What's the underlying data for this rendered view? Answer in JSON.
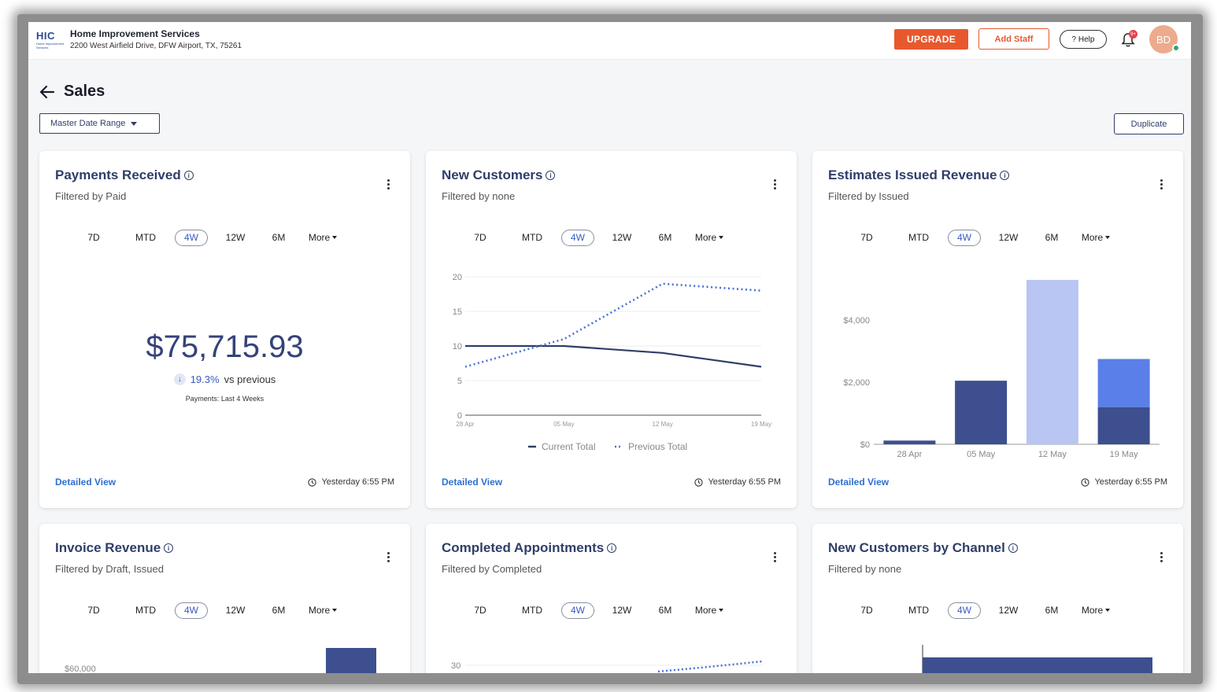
{
  "header": {
    "logo_text": "HIC",
    "logo_sub": "Home Improvement Services",
    "company_name": "Home Improvement Services",
    "company_address": "2200 West Airfield Drive, DFW Airport, TX, 75261",
    "upgrade_label": "UPGRADE",
    "add_staff_label": "Add Staff",
    "help_label": "? Help",
    "notification_badge": "9+",
    "avatar_initials": "BD",
    "accent_color": "#e8582d"
  },
  "page": {
    "title": "Sales",
    "date_range_label": "Master Date Range",
    "duplicate_label": "Duplicate"
  },
  "range_options": [
    "7D",
    "MTD",
    "4W",
    "12W",
    "6M"
  ],
  "range_more": "More",
  "cards": [
    {
      "title": "Payments Received",
      "filter": "Filtered by Paid",
      "active_range": "4W",
      "value": "$75,715.93",
      "delta_pct": "19.3%",
      "delta_vs": "vs previous",
      "delta_direction": "down",
      "period_note": "Payments: Last 4 Weeks",
      "detailed_view": "Detailed View",
      "updated": "Yesterday 6:55 PM"
    },
    {
      "title": "New Customers",
      "filter": "Filtered by none",
      "active_range": "4W",
      "detailed_view": "Detailed View",
      "updated": "Yesterday 6:55 PM"
    },
    {
      "title": "Estimates Issued Revenue",
      "filter": "Filtered by Issued",
      "active_range": "4W",
      "detailed_view": "Detailed View",
      "updated": "Yesterday 6:55 PM"
    },
    {
      "title": "Invoice Revenue",
      "filter": "Filtered by Draft, Issued",
      "active_range": "4W"
    },
    {
      "title": "Completed Appointments",
      "filter": "Filtered by Completed",
      "active_range": "4W"
    },
    {
      "title": "New Customers by Channel",
      "filter": "Filtered by none",
      "active_range": "4W"
    }
  ],
  "chart_data": [
    {
      "type": "line",
      "x": [
        "28 Apr",
        "05 May",
        "12 May",
        "19 May"
      ],
      "ylim": [
        0,
        20
      ],
      "yticks": [
        "0",
        "5",
        "10",
        "15",
        "20"
      ],
      "series": [
        {
          "name": "Current Total",
          "values": [
            10,
            10,
            9,
            7
          ],
          "color": "#2f3e6a",
          "style": "solid"
        },
        {
          "name": "Previous Total",
          "values": [
            7,
            11,
            19,
            18
          ],
          "color": "#4a72d4",
          "style": "dotted"
        }
      ],
      "legend": "bottom"
    },
    {
      "type": "bar",
      "stacked": true,
      "categories": [
        "28 Apr",
        "05 May",
        "12 May",
        "19 May"
      ],
      "ylim": [
        0,
        5400
      ],
      "yticks": [
        "$0",
        "$2,000",
        "$4,000"
      ],
      "series": [
        {
          "values": [
            120,
            2050,
            0,
            1200
          ],
          "color": "#3d4f8f"
        },
        {
          "values": [
            0,
            0,
            5300,
            0
          ],
          "color": "#b9c5f2"
        },
        {
          "values": [
            0,
            0,
            0,
            1550
          ],
          "color": "#5a7fe8"
        }
      ]
    },
    {
      "type": "bar",
      "yticks": [
        "$60,000"
      ],
      "series": [
        {
          "color": "#3d4f8f"
        }
      ]
    },
    {
      "type": "line",
      "yticks": [
        "30"
      ],
      "series": [
        {
          "color": "#4a72d4",
          "style": "dotted"
        }
      ]
    }
  ]
}
